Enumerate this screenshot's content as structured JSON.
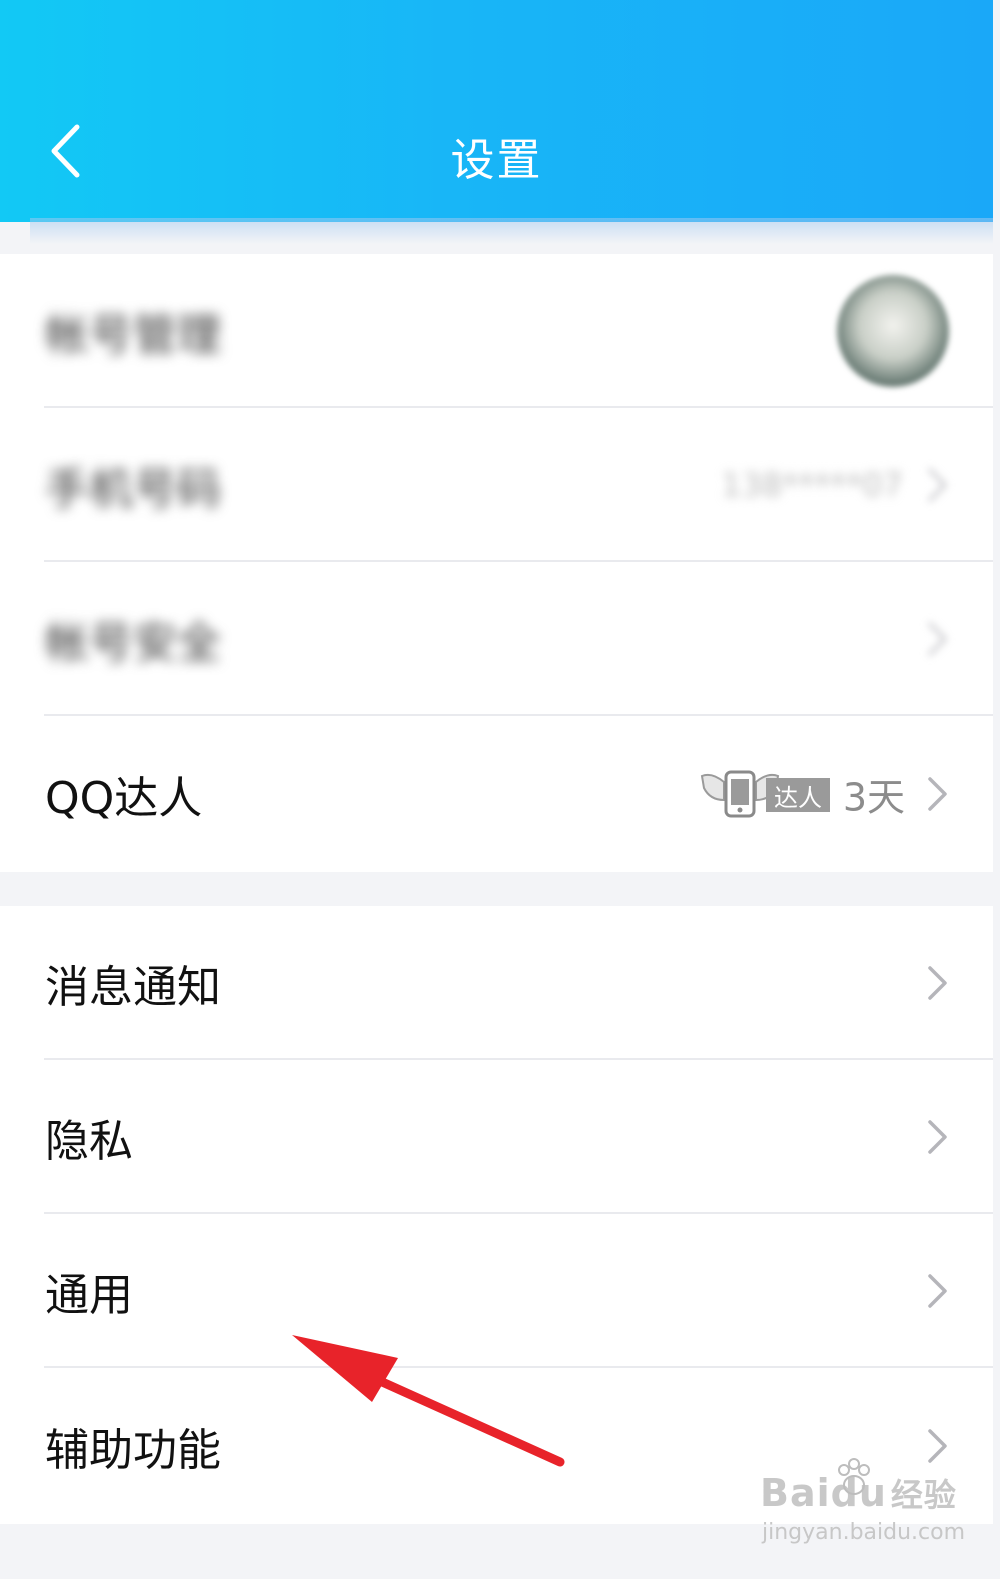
{
  "header": {
    "title": "设置"
  },
  "group1": [
    {
      "label": "帐号管理",
      "blurred": true
    },
    {
      "label": "手机号码",
      "value": "138*****07",
      "blurred": true
    },
    {
      "label": "帐号安全",
      "blurred": true
    },
    {
      "label": "QQ达人",
      "badge_text": "达人",
      "value": "3天"
    }
  ],
  "group2": [
    {
      "label": "消息通知"
    },
    {
      "label": "隐私"
    },
    {
      "label": "通用"
    },
    {
      "label": "辅助功能"
    }
  ],
  "watermark": {
    "logo": "Bai",
    "logo_suffix": "du",
    "logo_cn": "经验",
    "url": "jingyan.baidu.com"
  },
  "icons": {
    "back": "back-arrow-icon",
    "chevron": "chevron-right-icon",
    "badge": "winged-phone-icon",
    "annotation": "red-arrow"
  },
  "colors": {
    "header_gradient_start": "#12c9f5",
    "header_gradient_end": "#1aa8f8",
    "annotation_arrow": "#e8232a"
  }
}
